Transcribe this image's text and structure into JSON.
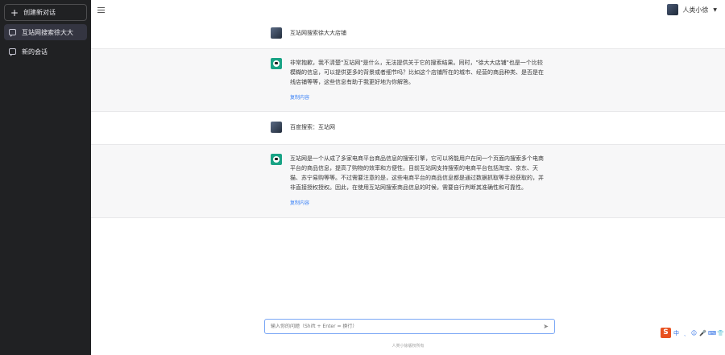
{
  "sidebar": {
    "new_chat_label": "创建新对话",
    "items": [
      {
        "label": "互站网搜索徐大大"
      },
      {
        "label": "新的会话"
      }
    ]
  },
  "header": {
    "user_name": "人类小徐",
    "caret": "▼"
  },
  "messages": [
    {
      "role": "user",
      "text": "互站网搜索徐大大店铺"
    },
    {
      "role": "bot",
      "text": "非常抱歉，我不清楚\"互站网\"是什么，无法提供关于它的搜索结果。同时，\"徐大大店铺\"也是一个比较模糊的信息，可以提供更多的背景或者细节吗？比如这个店铺所在的城市、经营的商品种类、是否是在线店铺等等，这些信息有助于我更好地为你解答。",
      "copy_label": "复制内容"
    },
    {
      "role": "user",
      "text": "百度搜索：互站网"
    },
    {
      "role": "bot",
      "text": "互站网是一个从成了多家电商平台商品信息的搜索引擎，它可以将能用户在同一个页面内搜索多个电商平台的商品信息，提高了购物的效率和方便性。目前互站网支持搜索的电商平台包括淘宝、京东、天猫、苏宁易购等等。不过需要注意的是，这些电商平台的商品信息都是通过数据抓取等手段获取的，并非直接授权授权。因此，在使用互站网搜索商品信息的时候，需要自行判断其准确性和可靠性。",
      "copy_label": "复制内容"
    }
  ],
  "input": {
    "placeholder": "输入你的问题（Shift + Enter = 换行）",
    "send_icon": "➤"
  },
  "footer": {
    "text": "人类小徐版权所有"
  },
  "ime": {
    "logo": "S",
    "glyphs": [
      "中",
      "ˎ",
      "☺",
      "🎤",
      "⌨",
      "👕",
      "⋮⋮"
    ]
  },
  "colors": {
    "sidebar_bg": "#202123",
    "bot_row_bg": "#f7f7f8",
    "accent": "#3b82f6",
    "bot_avatar": "#19a385"
  }
}
